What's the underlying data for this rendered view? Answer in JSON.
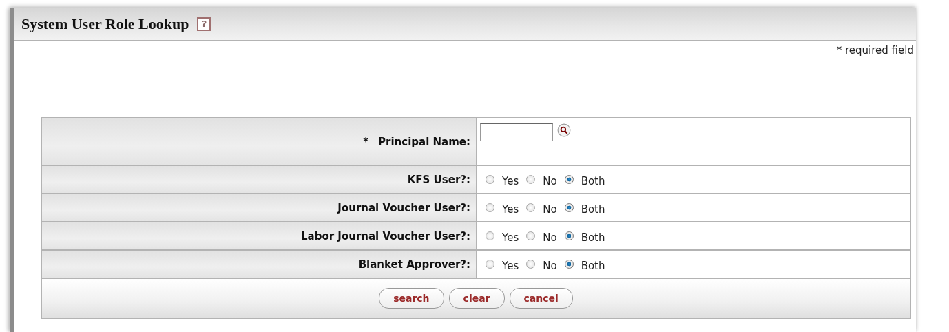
{
  "header": {
    "title": "System User Role Lookup",
    "help_icon": "?"
  },
  "required_note": "* required field",
  "fields": [
    {
      "kind": "text",
      "required_mark": "*",
      "label": "Principal Name:"
    },
    {
      "kind": "radio",
      "label": "KFS User?:",
      "options": [
        {
          "label": "Yes",
          "selected": false
        },
        {
          "label": "No",
          "selected": false
        },
        {
          "label": "Both",
          "selected": true
        }
      ]
    },
    {
      "kind": "radio",
      "label": "Journal Voucher User?:",
      "options": [
        {
          "label": "Yes",
          "selected": false
        },
        {
          "label": "No",
          "selected": false
        },
        {
          "label": "Both",
          "selected": true
        }
      ]
    },
    {
      "kind": "radio",
      "label": "Labor Journal Voucher User?:",
      "options": [
        {
          "label": "Yes",
          "selected": false
        },
        {
          "label": "No",
          "selected": false
        },
        {
          "label": "Both",
          "selected": true
        }
      ]
    },
    {
      "kind": "radio",
      "label": "Blanket Approver?:",
      "options": [
        {
          "label": "Yes",
          "selected": false
        },
        {
          "label": "No",
          "selected": false
        },
        {
          "label": "Both",
          "selected": true
        }
      ]
    }
  ],
  "buttons": [
    "search",
    "clear",
    "cancel"
  ]
}
